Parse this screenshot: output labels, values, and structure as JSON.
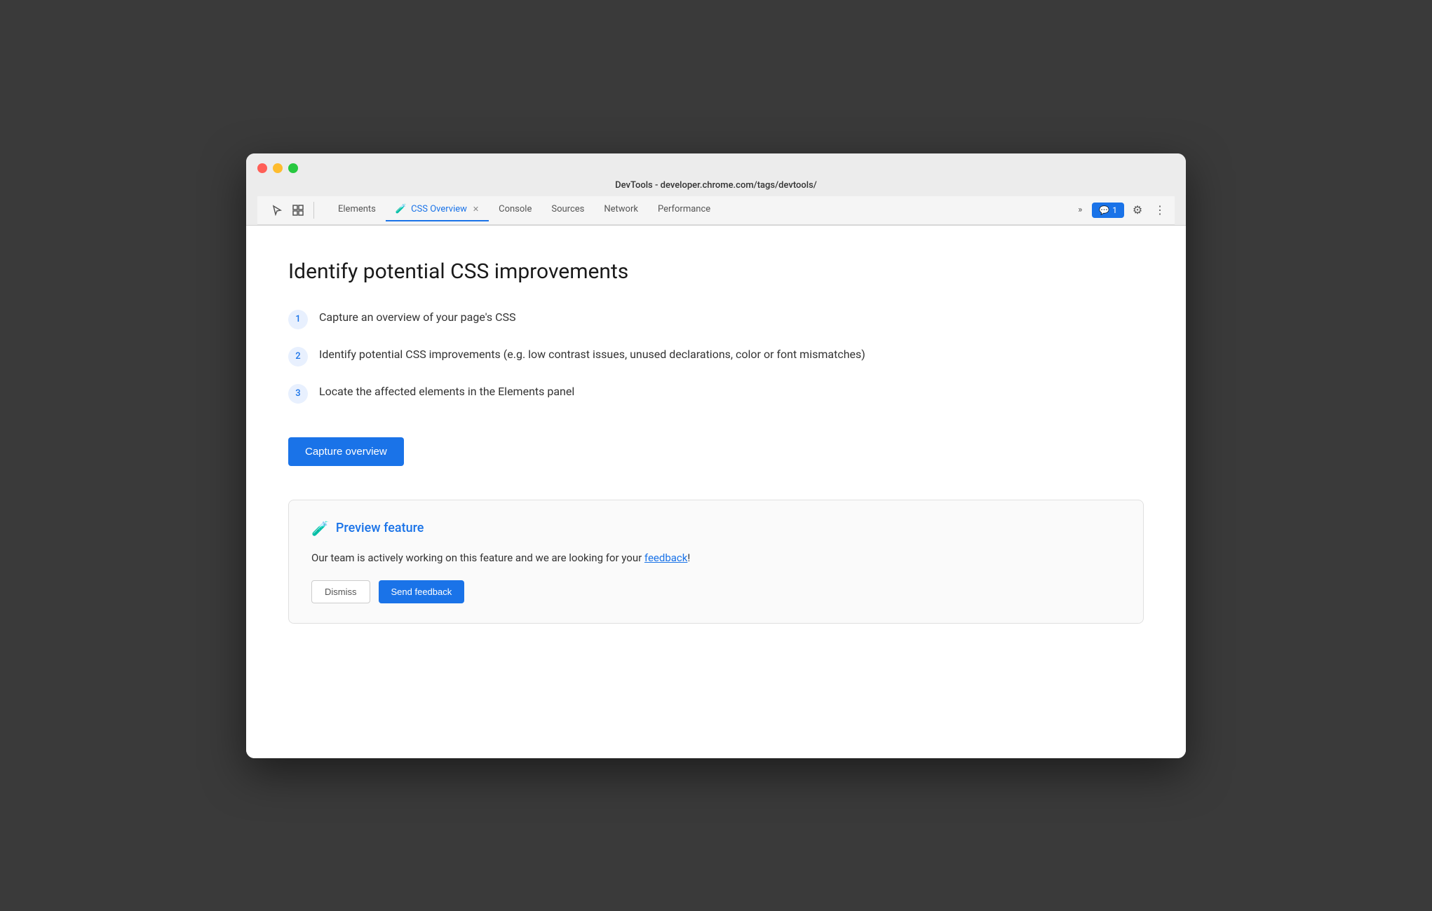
{
  "window": {
    "title": "DevTools - developer.chrome.com/tags/devtools/"
  },
  "traffic_lights": {
    "close_label": "close",
    "minimize_label": "minimize",
    "maximize_label": "maximize"
  },
  "tabs": {
    "items": [
      {
        "id": "elements",
        "label": "Elements",
        "active": false
      },
      {
        "id": "css-overview",
        "label": "CSS Overview",
        "active": true,
        "has_flask": true,
        "has_close": true
      },
      {
        "id": "console",
        "label": "Console",
        "active": false
      },
      {
        "id": "sources",
        "label": "Sources",
        "active": false
      },
      {
        "id": "network",
        "label": "Network",
        "active": false
      },
      {
        "id": "performance",
        "label": "Performance",
        "active": false
      }
    ],
    "more_label": "»",
    "notification_count": "1",
    "notification_icon": "💬",
    "gear_icon": "⚙",
    "more_icon": "⋮"
  },
  "main": {
    "page_title": "Identify potential CSS improvements",
    "steps": [
      {
        "number": "1",
        "text": "Capture an overview of your page's CSS"
      },
      {
        "number": "2",
        "text": "Identify potential CSS improvements (e.g. low contrast issues, unused declarations, color or font mismatches)"
      },
      {
        "number": "3",
        "text": "Locate the affected elements in the Elements panel"
      }
    ],
    "capture_button_label": "Capture overview",
    "preview_section": {
      "icon": "🧪",
      "title": "Preview feature",
      "body_text": "Our team is actively working on this feature and we are looking for your ",
      "link_text": "feedback",
      "body_suffix": "!"
    }
  },
  "colors": {
    "accent_blue": "#1a73e8",
    "step_bg": "#e8f0fe",
    "step_text": "#1a73e8"
  }
}
